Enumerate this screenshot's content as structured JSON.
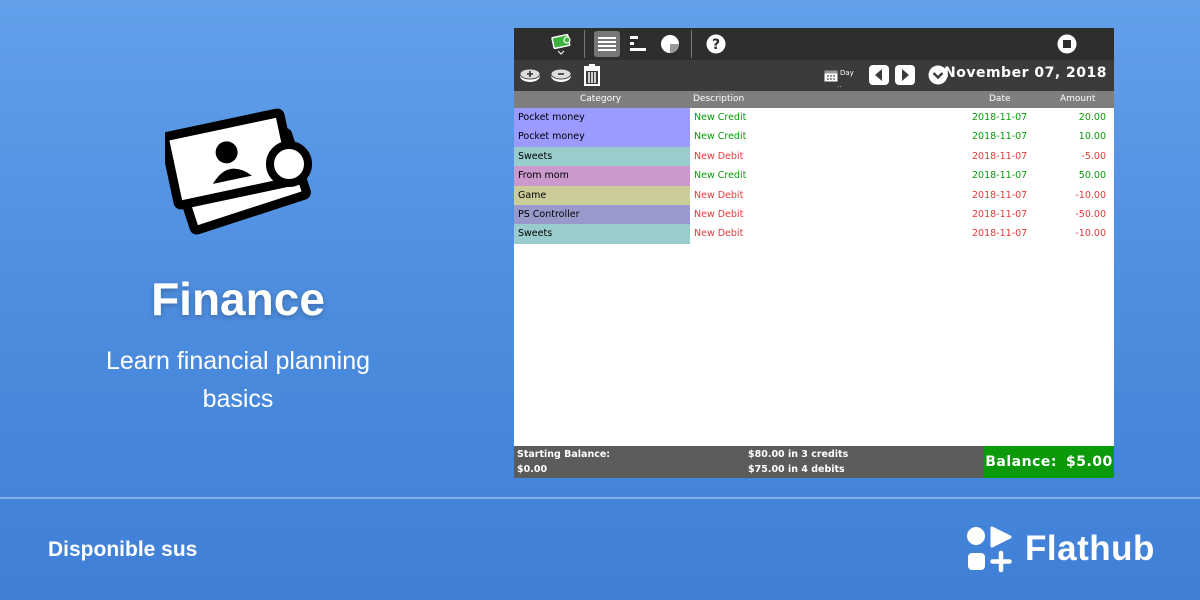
{
  "hero": {
    "app_name": "Finance",
    "summary": "Learn financial planning basics"
  },
  "footer": {
    "available_on": "Disponible sus",
    "store_name": "Flathub"
  },
  "window": {
    "toolbar": {
      "icons": [
        "finance-activity-icon",
        "list-view-icon",
        "chart-view-icon",
        "pie-chart-icon",
        "help-icon",
        "stop-icon"
      ]
    },
    "subtoolbar": {
      "icons": [
        "add-credit-icon",
        "add-debit-icon",
        "trash-icon",
        "calendar-icon",
        "previous-icon",
        "next-icon",
        "dropdown-icon"
      ],
      "period_label": "Day",
      "period_dots": "..",
      "date": "November 07, 2018"
    },
    "columns": {
      "category": "Category",
      "description": "Description",
      "date": "Date",
      "amount": "Amount"
    },
    "transactions": [
      {
        "category": "Pocket money",
        "description": "New Credit",
        "date": "2018-11-07",
        "amount": "20.00",
        "type": "credit",
        "color": "#9a9aff"
      },
      {
        "category": "Pocket money",
        "description": "New Credit",
        "date": "2018-11-07",
        "amount": "10.00",
        "type": "credit",
        "color": "#9a9aff"
      },
      {
        "category": "Sweets",
        "description": "New Debit",
        "date": "2018-11-07",
        "amount": "-5.00",
        "type": "debit",
        "color": "#99cccc"
      },
      {
        "category": "From mom",
        "description": "New Credit",
        "date": "2018-11-07",
        "amount": "50.00",
        "type": "credit",
        "color": "#cc99cc"
      },
      {
        "category": "Game",
        "description": "New Debit",
        "date": "2018-11-07",
        "amount": "-10.00",
        "type": "debit",
        "color": "#cccc99"
      },
      {
        "category": "PS Controller",
        "description": "New Debit",
        "date": "2018-11-07",
        "amount": "-50.00",
        "type": "debit",
        "color": "#9999cc"
      },
      {
        "category": "Sweets",
        "description": "New Debit",
        "date": "2018-11-07",
        "amount": "-10.00",
        "type": "debit",
        "color": "#99cccc"
      }
    ],
    "status": {
      "starting_balance_label": "Starting Balance:",
      "starting_balance_value": "$0.00",
      "credits_summary": "$80.00 in 3 credits",
      "debits_summary": "$75.00 in 4 debits",
      "balance_label": "Balance:",
      "balance_value": "$5.00"
    }
  },
  "colors": {
    "background_top": "#62a0ea",
    "background_bottom": "#3f7fd6",
    "credit": "#0a9a0a",
    "debit": "#e03a3a",
    "balance_box": "#0a9a0a"
  }
}
